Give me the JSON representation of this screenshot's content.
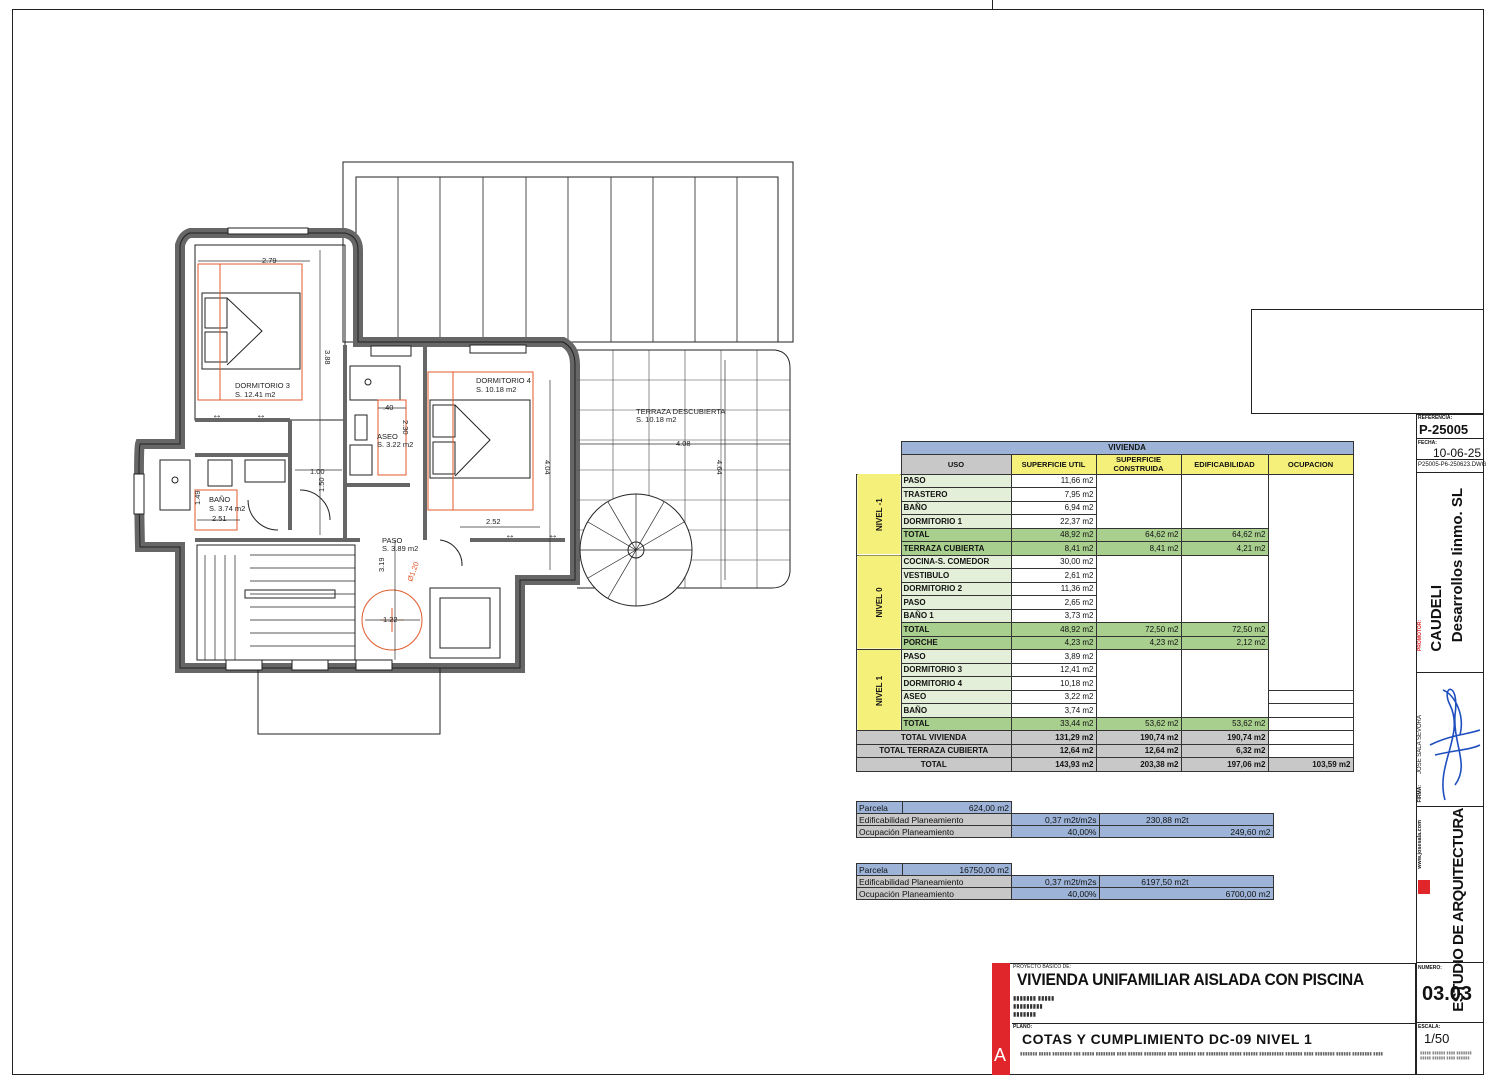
{
  "plan": {
    "rooms": [
      {
        "name": "DORMITORIO 3",
        "area": "S. 12.41 m2"
      },
      {
        "name": "DORMITORIO 4",
        "area": "S. 10.18 m2"
      },
      {
        "name": "ASEO",
        "area": "S. 3.22 m2"
      },
      {
        "name": "BAÑO",
        "area": "S. 3.74 m2"
      },
      {
        "name": "PASO",
        "area": "S. 3.89 m2"
      },
      {
        "name": "TERRAZA DESCUBIERTA",
        "area": "S. 10.18 m2"
      }
    ],
    "dims": [
      "2.79",
      "3.88",
      "1.00",
      "1.50",
      "2.52",
      "4.04",
      "4.08",
      "4.64",
      "3.19",
      "1.22",
      "Ø1.20",
      "2.51",
      "1.49",
      ".40",
      "2.30"
    ]
  },
  "table": {
    "title": "VIVIENDA",
    "headers": [
      "USO",
      "SUPERFICIE UTIL",
      "SUPERFICIE CONSTRUIDA",
      "EDIFICABILIDAD",
      "OCUPACION"
    ],
    "groups": [
      {
        "level": "NIVEL -1",
        "rows": [
          {
            "uso": "PASO",
            "util": "11,66 m2"
          },
          {
            "uso": "TRASTERO",
            "util": "7,95 m2"
          },
          {
            "uso": "BAÑO",
            "util": "6,94 m2"
          },
          {
            "uso": "DORMITORIO 1",
            "util": "22,37 m2"
          }
        ],
        "total": {
          "label": "TOTAL",
          "util": "48,92 m2",
          "constr": "64,62 m2",
          "edif": "64,62 m2"
        },
        "extra": {
          "label": "TERRAZA CUBIERTA",
          "util": "8,41 m2",
          "constr": "8,41 m2",
          "edif": "4,21 m2"
        }
      },
      {
        "level": "NIVEL 0",
        "rows": [
          {
            "uso": "COCINA-S. COMEDOR",
            "util": "30,00 m2"
          },
          {
            "uso": "VESTIBULO",
            "util": "2,61 m2"
          },
          {
            "uso": "DORMITORIO 2",
            "util": "11,36 m2"
          },
          {
            "uso": "PASO",
            "util": "2,65 m2"
          },
          {
            "uso": "BAÑO 1",
            "util": "3,73 m2"
          }
        ],
        "total": {
          "label": "TOTAL",
          "util": "48,92 m2",
          "constr": "72,50 m2",
          "edif": "72,50 m2"
        },
        "extra": {
          "label": "PORCHE",
          "util": "4,23 m2",
          "constr": "4,23 m2",
          "edif": "2,12 m2"
        }
      },
      {
        "level": "NIVEL 1",
        "rows": [
          {
            "uso": "PASO",
            "util": "3,89 m2"
          },
          {
            "uso": "DORMITORIO 3",
            "util": "12,41 m2"
          },
          {
            "uso": "DORMITORIO 4",
            "util": "10,18 m2"
          },
          {
            "uso": "ASEO",
            "util": "3,22 m2"
          },
          {
            "uso": "BAÑO",
            "util": "3,74 m2"
          }
        ],
        "total": {
          "label": "TOTAL",
          "util": "33,44 m2",
          "constr": "53,62 m2",
          "edif": "53,62 m2"
        }
      }
    ],
    "totals": [
      {
        "label": "TOTAL VIVIENDA",
        "util": "131,29 m2",
        "constr": "190,74 m2",
        "edif": "190,74 m2",
        "ocup": ""
      },
      {
        "label": "TOTAL TERRAZA CUBIERTA",
        "util": "12,64 m2",
        "constr": "12,64 m2",
        "edif": "6,32 m2",
        "ocup": ""
      },
      {
        "label": "TOTAL",
        "util": "143,93 m2",
        "constr": "203,38 m2",
        "edif": "197,06 m2",
        "ocup": "103,59 m2"
      }
    ]
  },
  "parcelas": [
    {
      "parcela_label": "Parcela",
      "parcela_value": "624,00 m2",
      "edif_label": "Edificabilidad Planeamiento",
      "edif_coef": "0,37 m2t/m2s",
      "edif_value": "230,88 m2t",
      "ocup_label": "Ocupación Planeamiento",
      "ocup_pct": "40,00%",
      "ocup_value": "249,60 m2"
    },
    {
      "parcela_label": "Parcela",
      "parcela_value": "16750,00 m2",
      "edif_label": "Edificabilidad Planeamiento",
      "edif_coef": "0,37 m2t/m2s",
      "edif_value": "6197,50 m2t",
      "ocup_label": "Ocupación Planeamiento",
      "ocup_pct": "40,00%",
      "ocup_value": "6700,00 m2"
    }
  ],
  "titleblock": {
    "proyecto_label": "PROYECTO BASICO DE:",
    "proyecto": "VIVIENDA UNIFAMILIAR AISLADA CON PISCINA",
    "plano_label": "PLANO:",
    "plano": "COTAS Y CUMPLIMIENTO DC-09 NIVEL 1",
    "referencia_label": "REFERENCIA:",
    "referencia": "P-25005",
    "fecha_label": "FECHA:",
    "fecha": "10-06-25",
    "archivo": "P25005-P6-250623.DWG",
    "promotor_label": "PROMOTOR:",
    "promotor_1": "CAUDELI",
    "promotor_2": "Desarrollos Iinmo. SL",
    "firma_label": "FIRMA:",
    "firma_nombre": "JOSE SALA SEVORA",
    "web": "www.josesala.com",
    "estudio": "ESTUDIO DE ARQUITECTURA",
    "numero_label": "NUMERO:",
    "numero": "03.03",
    "escala_label": "ESCALA:",
    "escala": "1/50",
    "logo_letter": "A"
  },
  "colors": {
    "plan_red": "#e05a2b",
    "table_blue": "#9db4d8",
    "table_yellow": "#f5f07a",
    "table_green": "#a8cf8e",
    "logo_red": "#e0262b"
  }
}
